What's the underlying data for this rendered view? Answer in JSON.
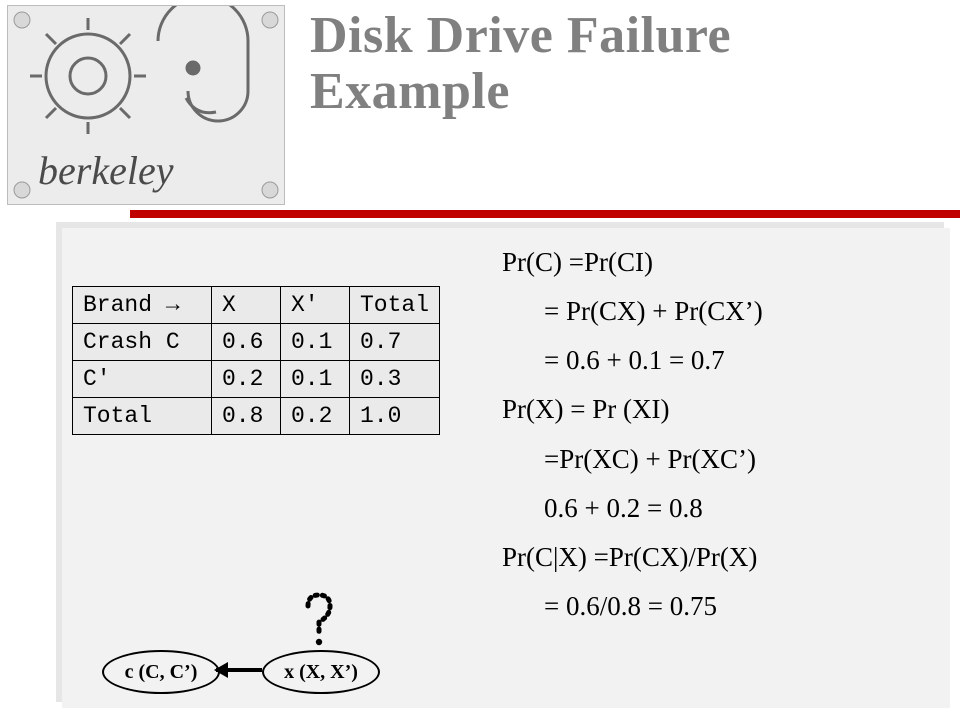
{
  "title_line1": "Disk Drive Failure",
  "title_line2": "Example",
  "table": {
    "rows": [
      [
        "Brand →",
        "X",
        "X'",
        "Total"
      ],
      [
        "Crash C",
        "0.6",
        "0.1",
        "0.7"
      ],
      [
        "C'",
        "0.2",
        "0.1",
        "0.3"
      ],
      [
        "Total",
        "0.8",
        "0.2",
        "1.0"
      ]
    ]
  },
  "math": {
    "l1": "Pr(C) =Pr(CI)",
    "l2": "= Pr(CX) + Pr(CX’)",
    "l3": "= 0.6 + 0.1 = 0.7",
    "l4": "Pr(X) = Pr (XI)",
    "l5": "=Pr(XC) + Pr(XC’)",
    "l6": "0.6 + 0.2 = 0.8",
    "l7": "Pr(C|X) =Pr(CX)/Pr(X)",
    "l8": "= 0.6/0.8 = 0.75"
  },
  "diagram": {
    "node_c": "c (C, C’)",
    "node_x": "x (X, X’)"
  },
  "logo_text": "berkeley"
}
